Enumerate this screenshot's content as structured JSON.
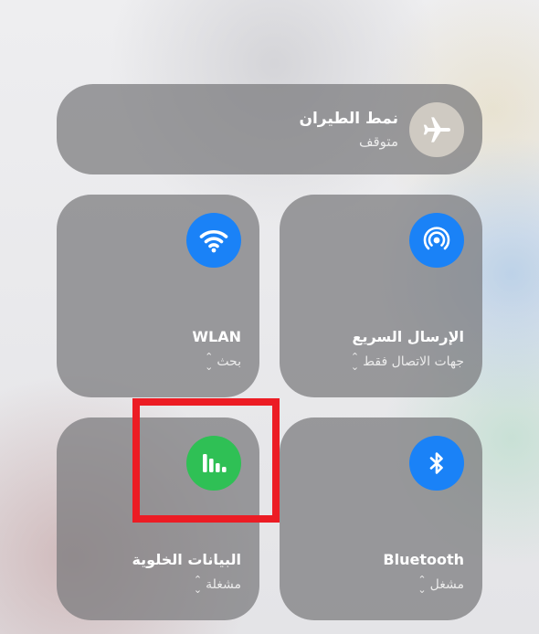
{
  "airplane_mode": {
    "title": "نمط الطيران",
    "status": "متوقف",
    "icon": "airplane-icon"
  },
  "airdrop": {
    "title": "الإرسال السريع",
    "status": "جهات الاتصال فقط",
    "icon": "airdrop-icon",
    "color": "#1a82f7"
  },
  "wifi": {
    "title": "WLAN",
    "status": "بحث",
    "icon": "wifi-icon",
    "color": "#1a82f7"
  },
  "bluetooth": {
    "title": "Bluetooth",
    "status": "مشغل",
    "icon": "bluetooth-icon",
    "color": "#1a82f7"
  },
  "cellular": {
    "title": "البيانات الخلوية",
    "status": "مشغلة",
    "icon": "cellular-icon",
    "color": "#2fc055"
  },
  "annotation": {
    "color": "#ec1c24"
  },
  "chevron": "⌃⌄"
}
